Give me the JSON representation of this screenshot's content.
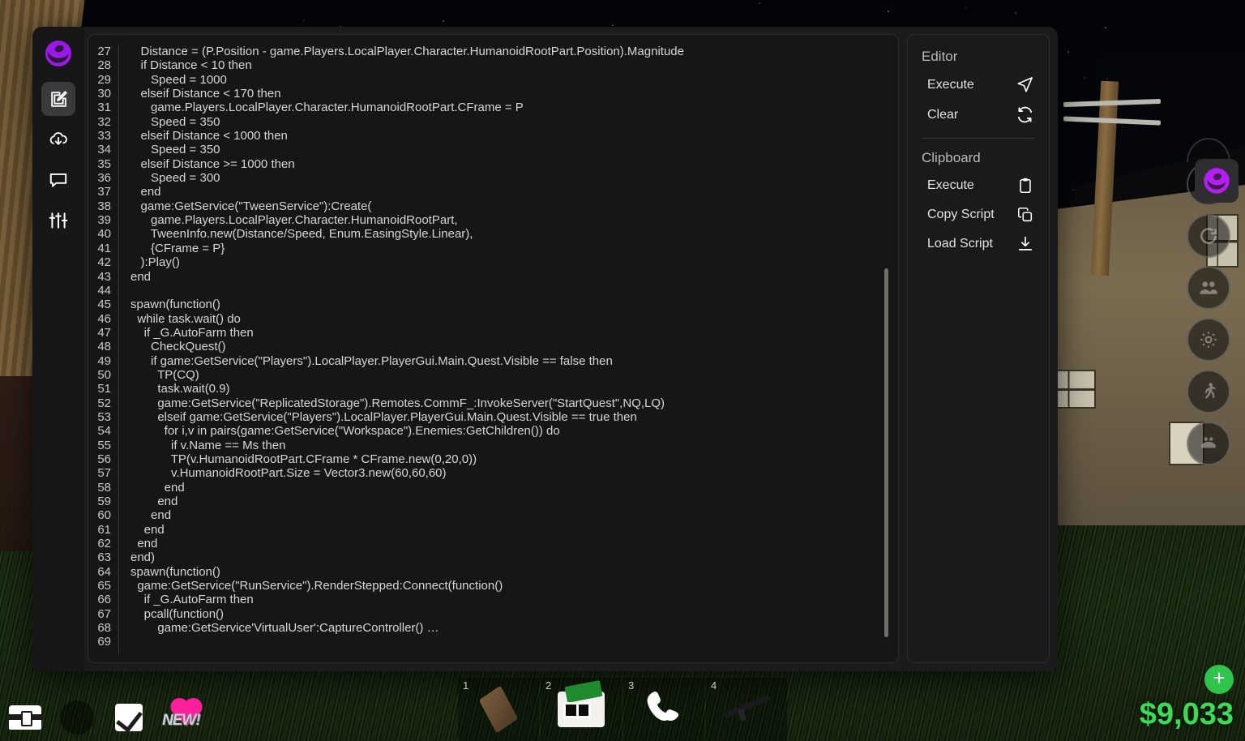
{
  "app": {
    "logo_name": "executor-logo"
  },
  "rail": {
    "items": [
      {
        "name": "editor-tab",
        "icon": "edit-square-icon",
        "active": true
      },
      {
        "name": "download-tab",
        "icon": "cloud-download-icon",
        "active": false
      },
      {
        "name": "chat-tab",
        "icon": "chat-bubble-icon",
        "active": false
      },
      {
        "name": "settings-tab",
        "icon": "sliders-icon",
        "active": false
      }
    ]
  },
  "editor": {
    "first_line_number": 27,
    "line_numbers": [
      27,
      28,
      29,
      30,
      31,
      32,
      33,
      34,
      35,
      36,
      37,
      38,
      39,
      40,
      41,
      42,
      43,
      44,
      45,
      46,
      47,
      48,
      49,
      50,
      51,
      52,
      53,
      54,
      55,
      56,
      57,
      58,
      59,
      60,
      61,
      62,
      63,
      64,
      65,
      66,
      67,
      68,
      69
    ],
    "code_lines": [
      "   Distance = (P.Position - game.Players.LocalPlayer.Character.HumanoidRootPart.Position).Magnitude",
      "   if Distance < 10 then",
      "      Speed = 1000",
      "   elseif Distance < 170 then",
      "      game.Players.LocalPlayer.Character.HumanoidRootPart.CFrame = P",
      "      Speed = 350",
      "   elseif Distance < 1000 then",
      "      Speed = 350",
      "   elseif Distance >= 1000 then",
      "      Speed = 300",
      "   end",
      "   game:GetService(\"TweenService\"):Create(",
      "      game.Players.LocalPlayer.Character.HumanoidRootPart,",
      "      TweenInfo.new(Distance/Speed, Enum.EasingStyle.Linear),",
      "      {CFrame = P}",
      "   ):Play()",
      "end",
      "",
      "spawn(function()",
      "  while task.wait() do",
      "    if _G.AutoFarm then",
      "      CheckQuest()",
      "      if game:GetService(\"Players\").LocalPlayer.PlayerGui.Main.Quest.Visible == false then",
      "        TP(CQ)",
      "        task.wait(0.9)",
      "        game:GetService(\"ReplicatedStorage\").Remotes.CommF_:InvokeServer(\"StartQuest\",NQ,LQ)",
      "        elseif game:GetService(\"Players\").LocalPlayer.PlayerGui.Main.Quest.Visible == true then",
      "          for i,v in pairs(game:GetService(\"Workspace\").Enemies:GetChildren()) do",
      "            if v.Name == Ms then",
      "            TP(v.HumanoidRootPart.CFrame * CFrame.new(0,20,0))",
      "            v.HumanoidRootPart.Size = Vector3.new(60,60,60)",
      "          end",
      "        end",
      "      end",
      "    end",
      "  end",
      "end)",
      "spawn(function()",
      "  game:GetService(\"RunService\").RenderStepped:Connect(function()",
      "    if _G.AutoFarm then",
      "    pcall(function()",
      "        game:GetService'VirtualUser':CaptureController() …",
      ""
    ]
  },
  "sidepanel": {
    "groups": [
      {
        "title": "Editor",
        "actions": [
          {
            "label": "Execute",
            "icon": "send-icon"
          },
          {
            "label": "Clear",
            "icon": "refresh-icon"
          }
        ]
      },
      {
        "title": "Clipboard",
        "actions": [
          {
            "label": "Execute",
            "icon": "clipboard-icon"
          },
          {
            "label": "Copy Script",
            "icon": "copy-icon"
          },
          {
            "label": "Load Script",
            "icon": "download-icon"
          }
        ]
      }
    ]
  },
  "hud": {
    "left_icons": [
      {
        "name": "chest-icon"
      },
      {
        "name": "dark-circle-icon"
      },
      {
        "name": "checkbox-icon"
      },
      {
        "name": "heart-new-icon",
        "badge": "NEW!"
      }
    ],
    "hotbar": [
      {
        "slot": "1",
        "name": "log-item"
      },
      {
        "slot": "2",
        "name": "wallet-item"
      },
      {
        "slot": "3",
        "name": "phone-item"
      },
      {
        "slot": "4",
        "name": "rifle-item"
      }
    ],
    "money": "$9,033",
    "add_money_label": "+",
    "side_buttons": [
      {
        "name": "shield-button"
      },
      {
        "name": "refresh-button"
      },
      {
        "name": "friends-button"
      },
      {
        "name": "settings-button"
      },
      {
        "name": "sprint-button"
      },
      {
        "name": "emote-button"
      }
    ],
    "executor_badge": "executor-toggle-button"
  },
  "colors": {
    "accent_purple": "#9b18e8",
    "money_green": "#3ddb54",
    "heart_pink": "#ff1f9c",
    "window_bg": "#1b1b1c",
    "code_text": "#d6d6d8"
  }
}
